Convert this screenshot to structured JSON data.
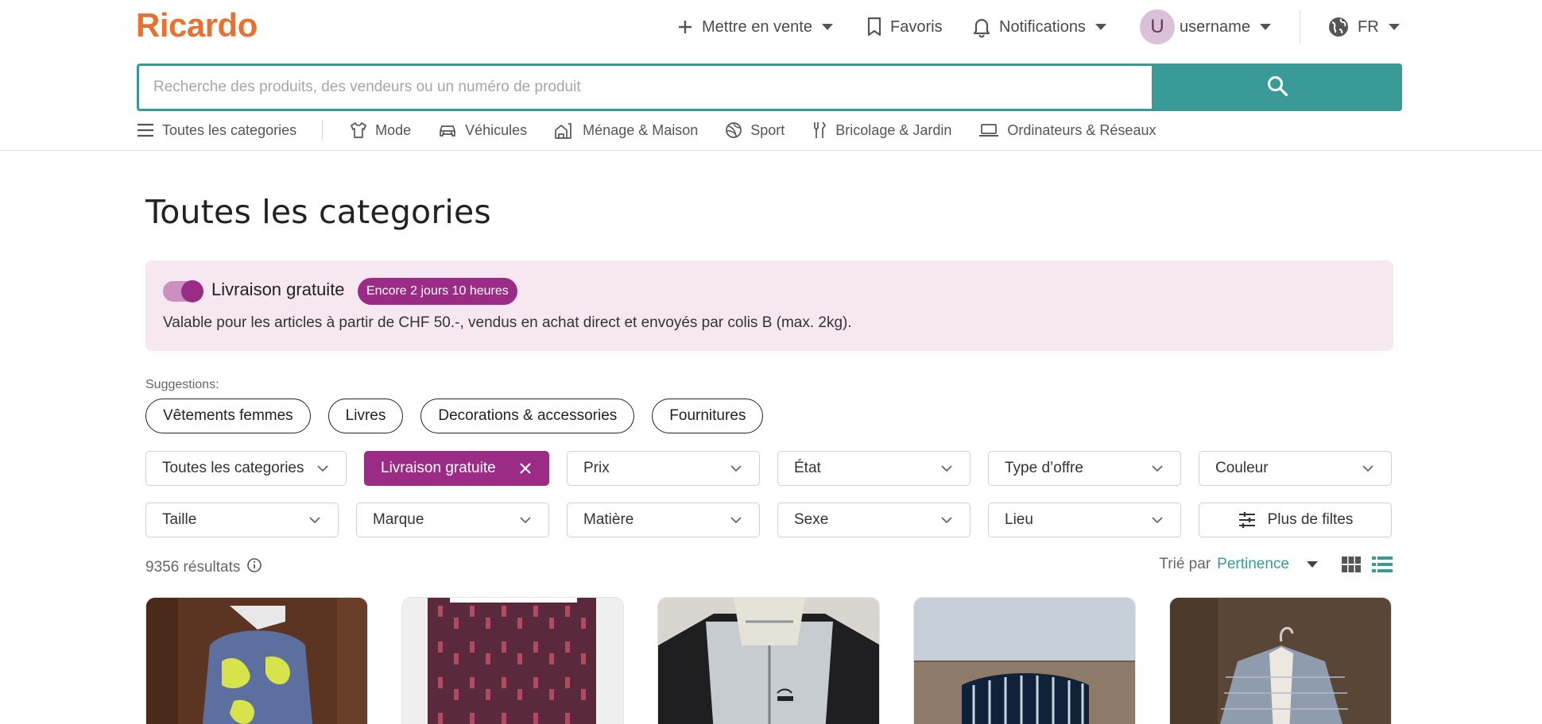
{
  "header": {
    "logo": "Ricardo",
    "sell_label": "Mettre en vente",
    "favorites_label": "Favoris",
    "notifications_label": "Notifications",
    "avatar_initial": "U",
    "username": "username",
    "language": "FR"
  },
  "search": {
    "placeholder": "Recherche des produits, des vendeurs ou un numéro de produit",
    "value": ""
  },
  "category_nav": {
    "all_label": "Toutes les categories",
    "items": [
      {
        "label": "Mode",
        "icon": "tshirt-icon"
      },
      {
        "label": "Véhicules",
        "icon": "car-icon"
      },
      {
        "label": "Ménage & Maison",
        "icon": "house-icon"
      },
      {
        "label": "Sport",
        "icon": "ball-icon"
      },
      {
        "label": "Bricolage & Jardin",
        "icon": "tools-icon"
      },
      {
        "label": "Ordinateurs & Réseaux",
        "icon": "laptop-icon"
      }
    ]
  },
  "page": {
    "title": "Toutes les categories"
  },
  "promo": {
    "toggle_on": true,
    "title": "Livraison gratuite",
    "badge": "Encore 2 jours 10 heures",
    "text": "Valable pour les articles à partir de CHF 50.-, vendus en achat direct et envoyés par colis B (max. 2kg)."
  },
  "suggestions": {
    "label": "Suggestions:",
    "chips": [
      "Vêtements femmes",
      "Livres",
      "Decorations & accessories",
      "Fournitures"
    ]
  },
  "filters": {
    "row1": [
      {
        "label": "Toutes les categories",
        "active": false
      },
      {
        "label": "Livraison gratuite",
        "active": true
      },
      {
        "label": "Prix",
        "active": false
      },
      {
        "label": "État",
        "active": false
      },
      {
        "label": "Type d’offre",
        "active": false
      },
      {
        "label": "Couleur",
        "active": false
      }
    ],
    "row2": [
      {
        "label": "Taille"
      },
      {
        "label": "Marque"
      },
      {
        "label": "Matière"
      },
      {
        "label": "Sexe"
      },
      {
        "label": "Lieu"
      }
    ],
    "more_label": "Plus de filtes"
  },
  "results": {
    "count": "9356 résultats",
    "sort_label": "Trié par",
    "sort_value": "Pertinence"
  },
  "colors": {
    "brand_orange": "#e57231",
    "teal": "#3a9a98",
    "purple": "#9b2c86",
    "promo_bg": "#f6e7f1"
  }
}
